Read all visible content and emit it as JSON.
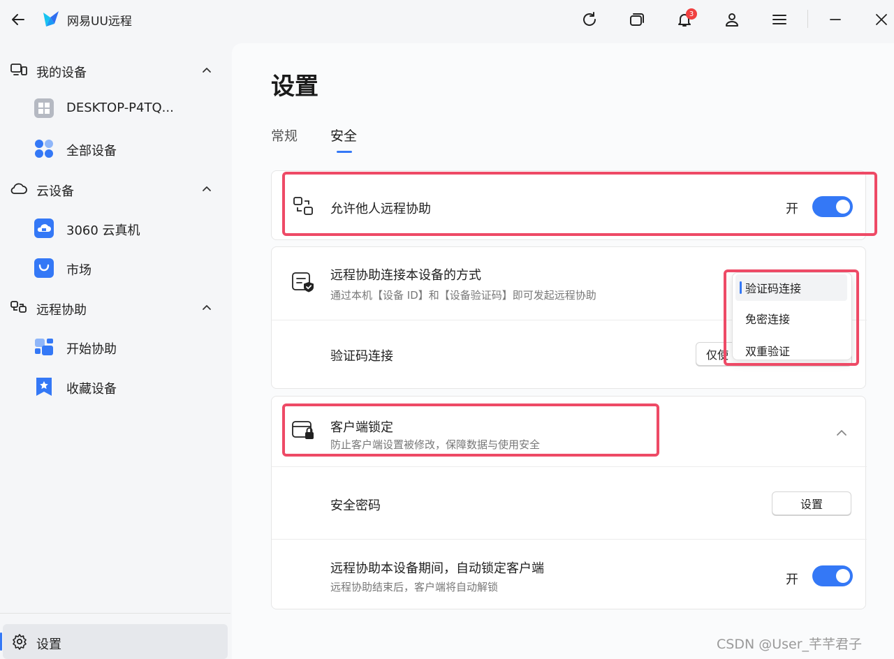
{
  "app": {
    "title": "网易UU远程",
    "notification_count": "3"
  },
  "sidebar": {
    "groups": [
      {
        "label": "我的设备",
        "items": [
          {
            "label": "DESKTOP-P4TQ..."
          },
          {
            "label": "全部设备"
          }
        ]
      },
      {
        "label": "云设备",
        "items": [
          {
            "label": "3060 云真机"
          },
          {
            "label": "市场"
          }
        ]
      },
      {
        "label": "远程协助",
        "items": [
          {
            "label": "开始协助"
          },
          {
            "label": "收藏设备"
          }
        ]
      }
    ],
    "settings_label": "设置"
  },
  "main": {
    "title": "设置",
    "tabs": [
      {
        "label": "常规"
      },
      {
        "label": "安全"
      }
    ],
    "active_tab": 1,
    "allow_remote": {
      "title": "允许他人远程协助",
      "toggle_label": "开",
      "on": true
    },
    "connect_method": {
      "title": "远程协助连接本设备的方式",
      "subtitle": "通过本机【设备 ID】和【设备验证码】即可发起远程协助",
      "verify_row_title": "验证码连接",
      "verify_button_partial": "仅使",
      "dropdown_options": [
        {
          "label": "验证码连接"
        },
        {
          "label": "免密连接"
        },
        {
          "label": "双重验证"
        }
      ],
      "selected_option": 0
    },
    "client_lock": {
      "title": "客户端锁定",
      "subtitle": "防止客户端设置被修改，保障数据与使用安全",
      "password_row_title": "安全密码",
      "password_button": "设置",
      "auto_lock_title": "远程协助本设备期间，自动锁定客户端",
      "auto_lock_subtitle": "远程协助结束后，客户端将自动解锁",
      "auto_lock_toggle_label": "开",
      "auto_lock_on": true
    }
  },
  "watermark": "CSDN @User_芊芊君子",
  "colors": {
    "accent": "#3478f6",
    "highlight": "#ee4a66",
    "badge": "#f04040"
  }
}
